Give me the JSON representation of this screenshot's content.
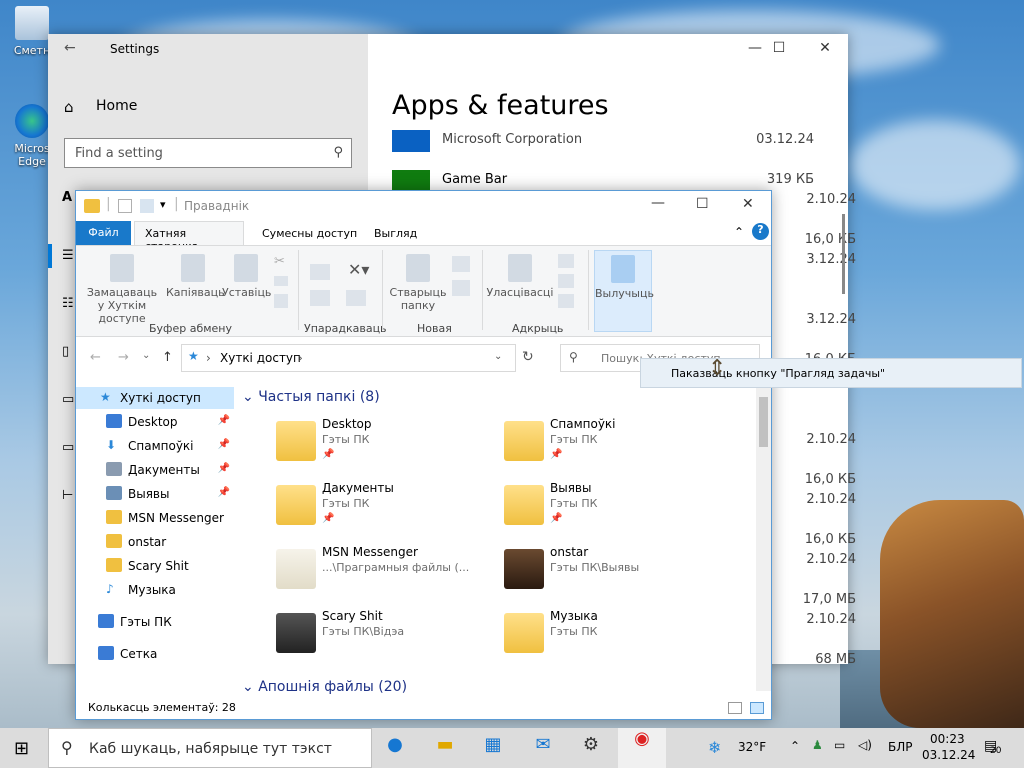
{
  "desktop": {
    "icons": [
      {
        "label": "Сметн"
      },
      {
        "label": "Micros Edge"
      }
    ]
  },
  "settings": {
    "title": "Settings",
    "home": "Home",
    "search_placeholder": "Find a setting",
    "page_title": "Apps & features",
    "apps": [
      {
        "name": "Microsoft Corporation",
        "value": "03.12.24",
        "color": "#0a61c2"
      },
      {
        "name": "Game Bar",
        "value": "319 КБ",
        "color": "#107c10"
      }
    ],
    "side_values": [
      "2.10.24",
      "16,0 КБ",
      "3.12.24",
      "3.12.24",
      "16,0 КБ",
      "2.10.24",
      "16,0 КБ",
      "2.10.24",
      "16,0 КБ",
      "2.10.24",
      "17,0 МБ",
      "2.10.24",
      "68 МБ"
    ],
    "left_letter": "А"
  },
  "explorer": {
    "title": "Праваднік",
    "tabs": {
      "file": "Файл",
      "home": "Хатняя старонка",
      "share": "Сумесны доступ",
      "view": "Выгляд"
    },
    "ribbon": {
      "pin": "Замацаваць у Хуткім доступе",
      "copy": "Капіяваць",
      "paste": "Уставіць",
      "group_clipboard": "Буфер абмену",
      "group_organize": "Упарадкаваць",
      "new_folder": "Стварыць папку",
      "group_new": "Новая",
      "properties": "Уласцівасці",
      "group_open": "Адкрыць",
      "select": "Вылучыць"
    },
    "address": {
      "path": "Хуткі доступ",
      "search_placeholder": "Пошук: Хуткі доступ"
    },
    "nav": [
      {
        "label": "Хуткі доступ",
        "pin": false,
        "color": "#2b88d8"
      },
      {
        "label": "Desktop",
        "pin": true,
        "color": "#3a7bd5"
      },
      {
        "label": "Спампоўкі",
        "pin": true,
        "color": "#2b88d8"
      },
      {
        "label": "Дакументы",
        "pin": true,
        "color": "#8a9bb0"
      },
      {
        "label": "Выявы",
        "pin": true,
        "color": "#6b8fb6"
      },
      {
        "label": "MSN Messenger",
        "pin": false,
        "color": "#f0c040"
      },
      {
        "label": "onstar",
        "pin": false,
        "color": "#f0c040"
      },
      {
        "label": "Scary Shit",
        "pin": false,
        "color": "#f0c040"
      },
      {
        "label": "Музыка",
        "pin": false,
        "color": "#2b88d8"
      },
      {
        "label": "Гэты ПК",
        "pin": false,
        "color": "#3a7bd5"
      },
      {
        "label": "Сетка",
        "pin": false,
        "color": "#3a7bd5"
      }
    ],
    "group_header": "Частыя папкі (8)",
    "group_header2": "Апошнія файлы (20)",
    "folders": [
      {
        "name": "Desktop",
        "sub": "Гэты ПК",
        "pin": true
      },
      {
        "name": "Спампоўкі",
        "sub": "Гэты ПК",
        "pin": true
      },
      {
        "name": "Дакументы",
        "sub": "Гэты ПК",
        "pin": true
      },
      {
        "name": "Выявы",
        "sub": "Гэты ПК",
        "pin": true
      },
      {
        "name": "MSN Messenger",
        "sub": "...\\Праграмныя файлы (...",
        "pin": false
      },
      {
        "name": "onstar",
        "sub": "Гэты ПК\\Выявы",
        "pin": false
      },
      {
        "name": "Scary Shit",
        "sub": "Гэты ПК\\Відэа",
        "pin": false
      },
      {
        "name": "Музыка",
        "sub": "Гэты ПК",
        "pin": false
      }
    ],
    "status": "Колькасць элементаў: 28",
    "pin_glyph": "📌"
  },
  "tooltip": "Паказваць кнопку \"Прагляд задачы\"",
  "taskbar": {
    "search": "Каб шукаць, набярыце тут тэкст",
    "weather": "32°F",
    "lang": "БЛР",
    "time": "00:23",
    "date": "03.12.24",
    "notifications": "20"
  }
}
